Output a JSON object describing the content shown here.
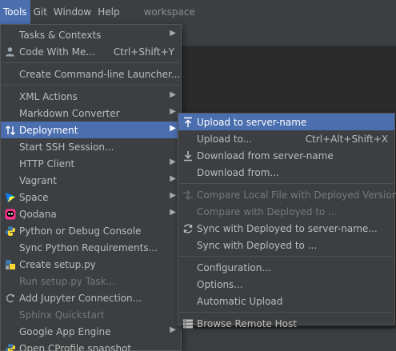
{
  "menubar": {
    "items": [
      "Tools",
      "Git",
      "Window",
      "Help"
    ],
    "project": "workspace"
  },
  "tools_menu": {
    "items": [
      {
        "label": "Tasks & Contexts"
      },
      {
        "label": "Code With Me...",
        "shortcut": "Ctrl+Shift+Y"
      },
      {
        "label": "Create Command-line Launcher..."
      },
      {
        "label": "XML Actions"
      },
      {
        "label": "Markdown Converter"
      },
      {
        "label": "Deployment"
      },
      {
        "label": "Start SSH Session..."
      },
      {
        "label": "HTTP Client"
      },
      {
        "label": "Vagrant"
      },
      {
        "label": "Space"
      },
      {
        "label": "Qodana"
      },
      {
        "label": "Python or Debug Console"
      },
      {
        "label": "Sync Python Requirements..."
      },
      {
        "label": "Create setup.py"
      },
      {
        "label": "Run setup.py Task..."
      },
      {
        "label": "Add Jupyter Connection..."
      },
      {
        "label": "Sphinx Quickstart"
      },
      {
        "label": "Google App Engine"
      },
      {
        "label": "Open CProfile snapshot"
      }
    ]
  },
  "deployment_menu": {
    "items": [
      {
        "label": "Upload to server-name"
      },
      {
        "label": "Upload to...",
        "shortcut": "Ctrl+Alt+Shift+X"
      },
      {
        "label": "Download from server-name"
      },
      {
        "label": "Download from..."
      },
      {
        "label": "Compare Local File with Deployed Version"
      },
      {
        "label": "Compare with Deployed to ..."
      },
      {
        "label": "Sync with Deployed to server-name..."
      },
      {
        "label": "Sync with Deployed to ..."
      },
      {
        "label": "Configuration..."
      },
      {
        "label": "Options..."
      },
      {
        "label": "Automatic Upload"
      },
      {
        "label": "Browse Remote Host"
      }
    ]
  },
  "colors": {
    "menu_bg": "#3c3f41",
    "selection": "#4b6eaf",
    "text": "#bbbbbb",
    "disabled_text": "#777777"
  }
}
